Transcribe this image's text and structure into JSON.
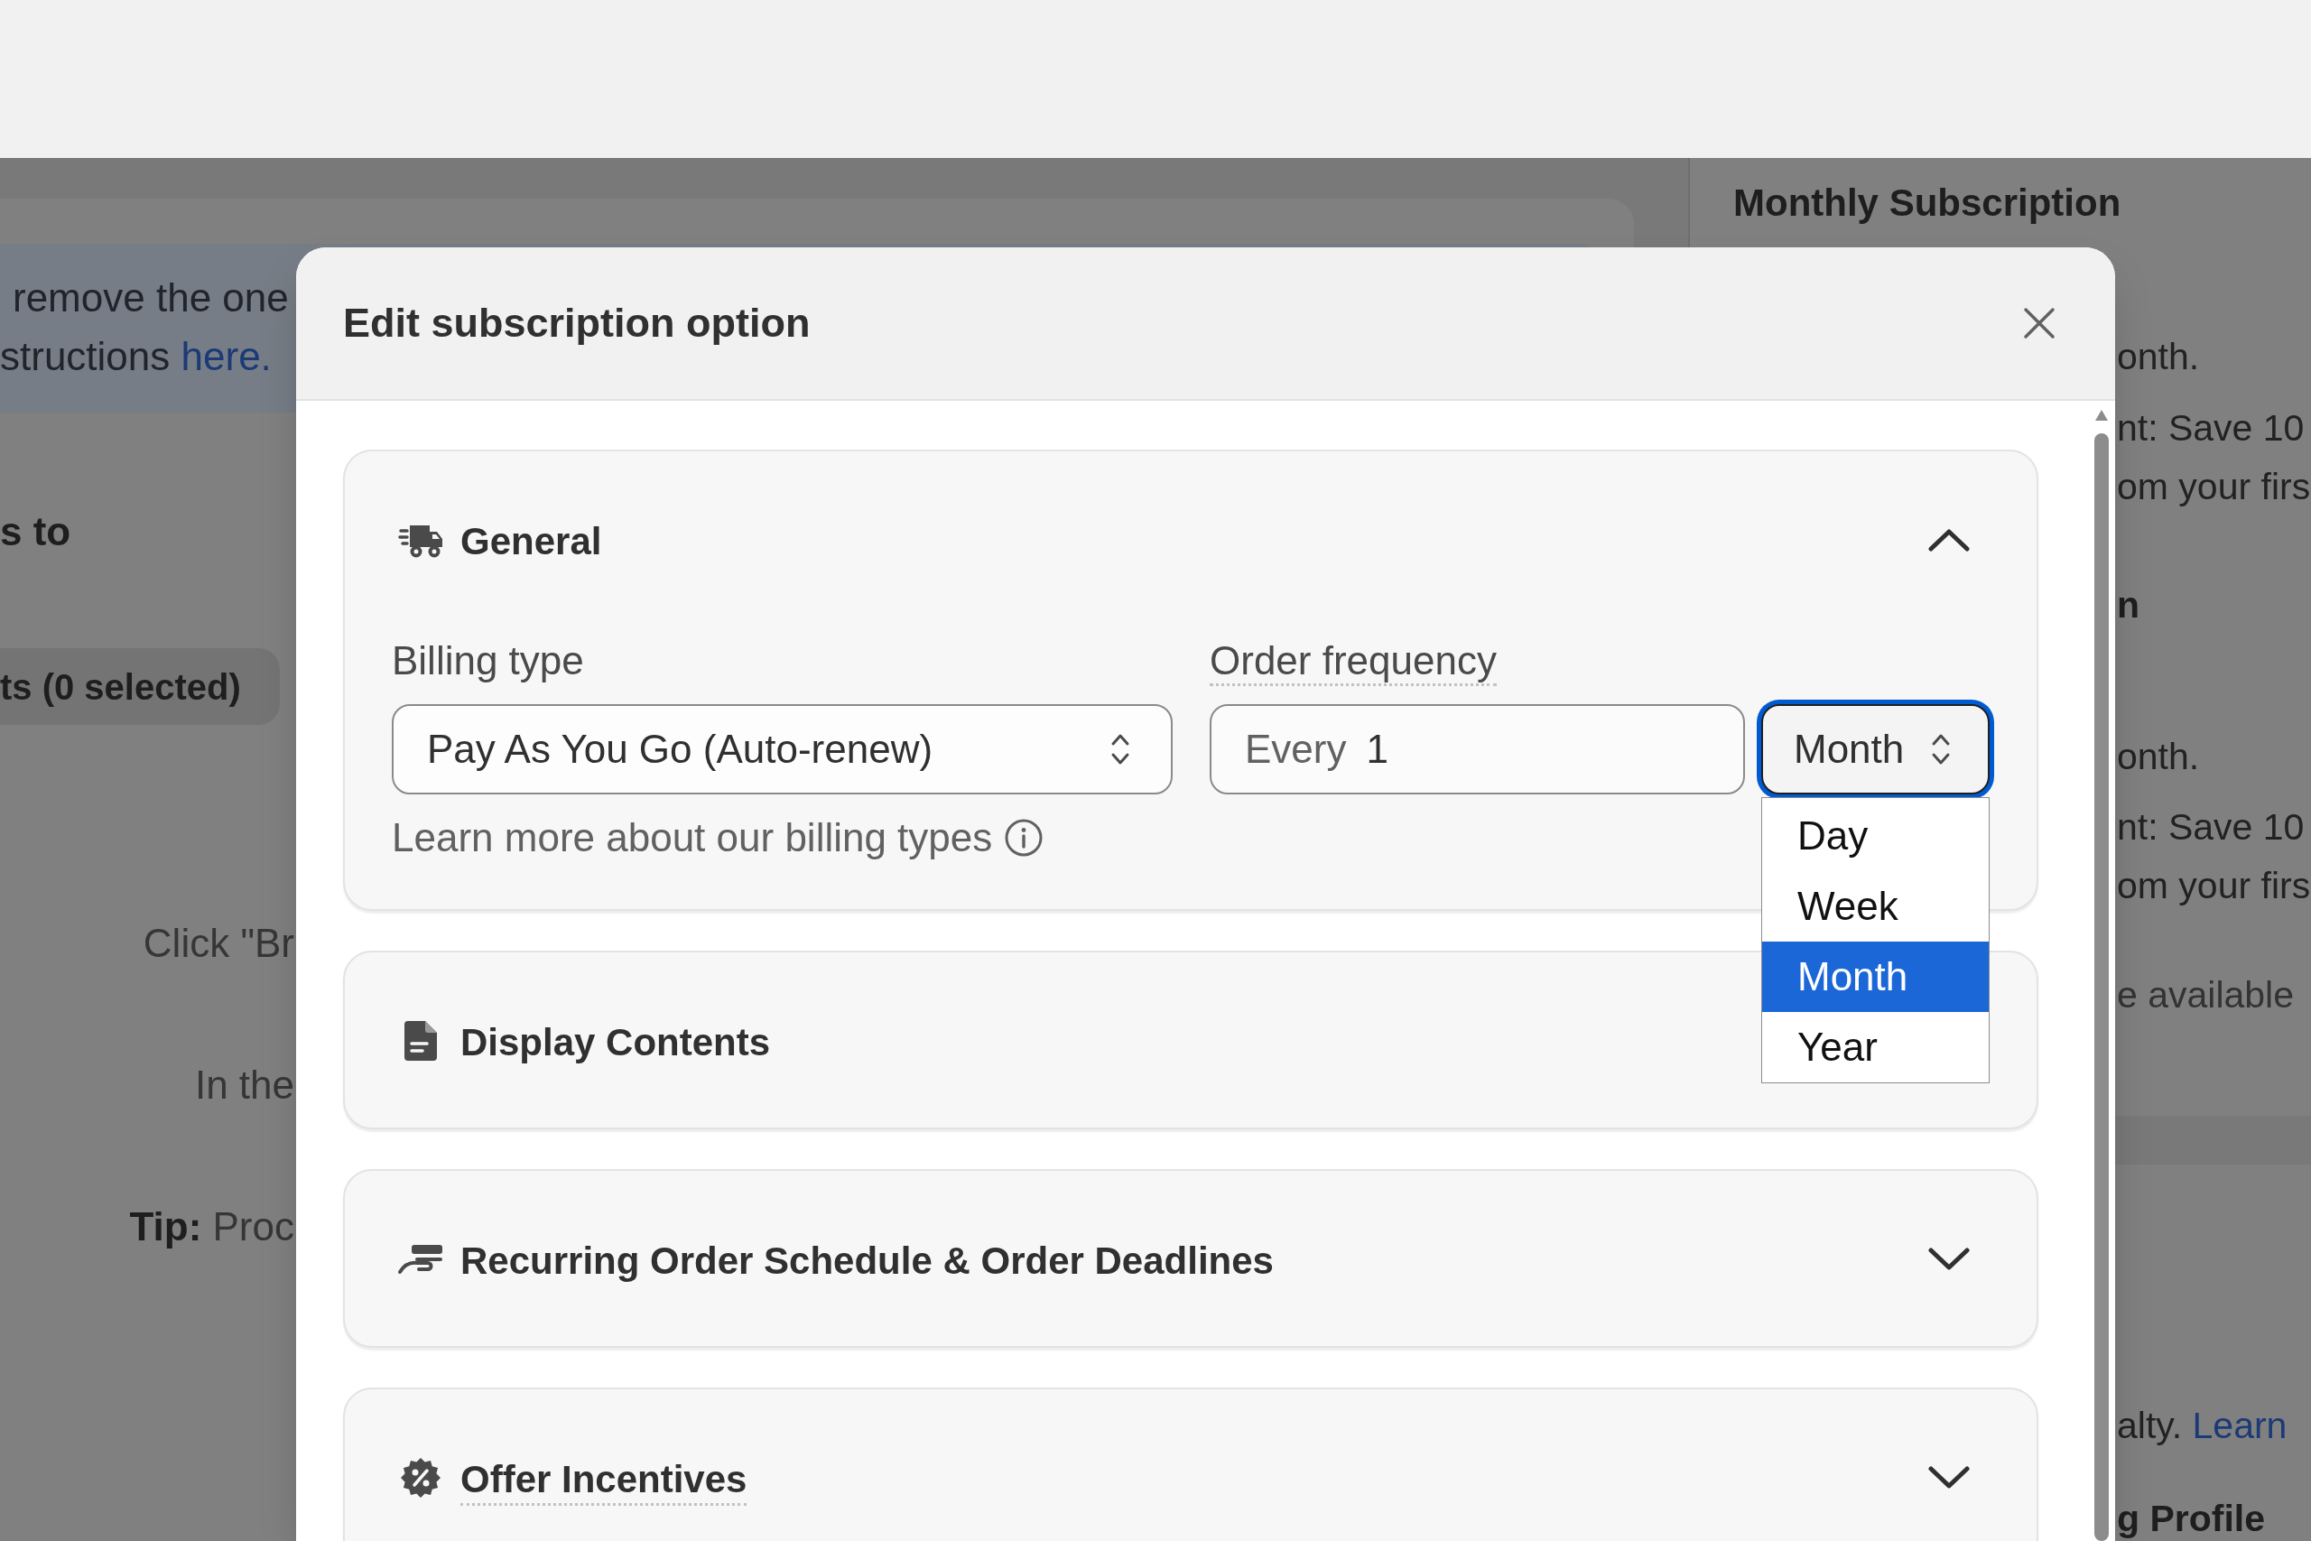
{
  "page": {
    "banner": {
      "lines": [
        {
          "text": "remove the one"
        },
        {
          "text": "structions",
          "link": "here."
        }
      ]
    },
    "heading": "s to",
    "button": "ts (0 selected)",
    "notes": [
      "Click \"Br",
      "In the",
      "**Tip:** Proc"
    ]
  },
  "side_panel": {
    "cards": [
      {
        "title": "Monthly Subscription",
        "lines": [
          {
            "kind": "text",
            "text": "onth."
          },
          {
            "kind": "text",
            "text": "nt: Save 10"
          },
          {
            "kind": "text",
            "text": "om your firs"
          },
          {
            "kind": "heading",
            "text": "n"
          },
          {
            "kind": "text",
            "text": "onth."
          },
          {
            "kind": "text",
            "text": "nt: Save 10"
          },
          {
            "kind": "text",
            "text": "om your firs"
          },
          {
            "kind": "note",
            "text": "e available"
          }
        ]
      },
      {
        "lines": [
          {
            "kind": "text",
            "text": "alty.",
            "link": "Learn"
          },
          {
            "kind": "heading",
            "text": "g Profile"
          }
        ]
      }
    ]
  },
  "dialog": {
    "title": "Edit subscription option",
    "sections": [
      {
        "title": "General",
        "has_tooltip": false,
        "expanded": true,
        "fields": {
          "billing_type": {
            "label": "Billing type",
            "has_tooltip": false,
            "value": "Pay As You Go (Auto-renew)",
            "help": "Learn more about our billing types"
          },
          "order_frequency": {
            "label": "Order frequency",
            "has_tooltip": true,
            "prefix": "Every",
            "value": "1",
            "unit": {
              "value": "Month",
              "focused": true,
              "open": true,
              "options": [
                {
                  "label": "Day",
                  "selected": false
                },
                {
                  "label": "Week",
                  "selected": false
                },
                {
                  "label": "Month",
                  "selected": true
                },
                {
                  "label": "Year",
                  "selected": false
                }
              ]
            }
          }
        }
      },
      {
        "title": "Display Contents",
        "has_tooltip": false
      },
      {
        "title": "Recurring Order Schedule & Order Deadlines",
        "has_tooltip": false,
        "expanded": false
      },
      {
        "title": "Offer Incentives",
        "has_tooltip": true,
        "expanded": false
      }
    ]
  }
}
